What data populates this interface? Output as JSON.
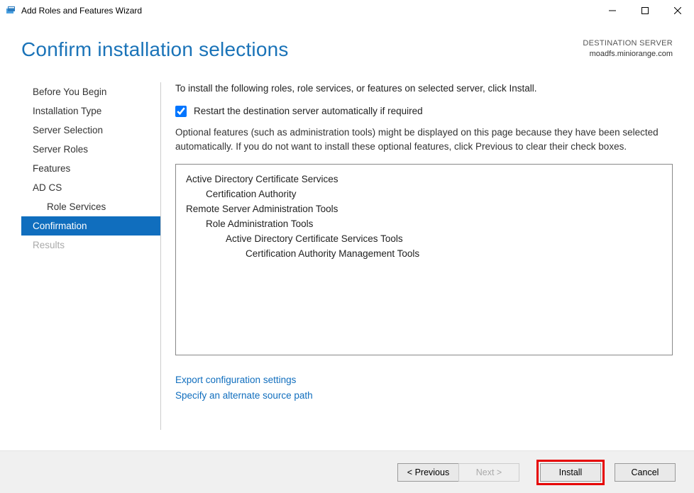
{
  "window": {
    "title": "Add Roles and Features Wizard"
  },
  "header": {
    "page_title": "Confirm installation selections",
    "dest_label": "DESTINATION SERVER",
    "dest_name": "moadfs.miniorange.com"
  },
  "nav": {
    "items": [
      {
        "label": "Before You Begin",
        "indent": false,
        "active": false,
        "disabled": false
      },
      {
        "label": "Installation Type",
        "indent": false,
        "active": false,
        "disabled": false
      },
      {
        "label": "Server Selection",
        "indent": false,
        "active": false,
        "disabled": false
      },
      {
        "label": "Server Roles",
        "indent": false,
        "active": false,
        "disabled": false
      },
      {
        "label": "Features",
        "indent": false,
        "active": false,
        "disabled": false
      },
      {
        "label": "AD CS",
        "indent": false,
        "active": false,
        "disabled": false
      },
      {
        "label": "Role Services",
        "indent": true,
        "active": false,
        "disabled": false
      },
      {
        "label": "Confirmation",
        "indent": false,
        "active": true,
        "disabled": false
      },
      {
        "label": "Results",
        "indent": false,
        "active": false,
        "disabled": true
      }
    ]
  },
  "content": {
    "intro": "To install the following roles, role services, or features on selected server, click Install.",
    "restart_checked": true,
    "restart_label": "Restart the destination server automatically if required",
    "subtext": "Optional features (such as administration tools) might be displayed on this page because they have been selected automatically. If you do not want to install these optional features, click Previous to clear their check boxes.",
    "install_items": [
      {
        "label": "Active Directory Certificate Services",
        "level": 0
      },
      {
        "label": "Certification Authority",
        "level": 1
      },
      {
        "label": "Remote Server Administration Tools",
        "level": 0
      },
      {
        "label": "Role Administration Tools",
        "level": 1
      },
      {
        "label": "Active Directory Certificate Services Tools",
        "level": 2
      },
      {
        "label": "Certification Authority Management Tools",
        "level": 3
      }
    ],
    "link1": "Export configuration settings",
    "link2": "Specify an alternate source path"
  },
  "footer": {
    "previous": "< Previous",
    "next": "Next >",
    "install": "Install",
    "cancel": "Cancel"
  }
}
